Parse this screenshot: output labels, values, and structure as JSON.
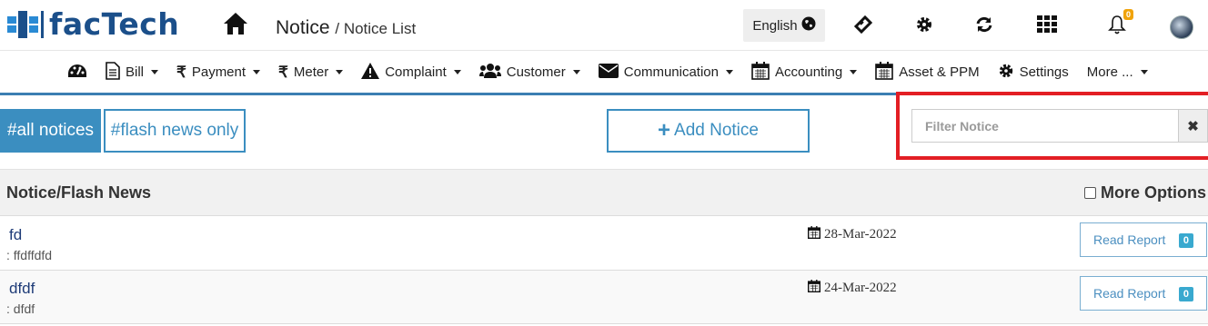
{
  "brand": {
    "name": "facTech"
  },
  "header": {
    "title": "Notice",
    "subtitle": "/ Notice List",
    "language": "English",
    "notification_count": "0"
  },
  "nav": {
    "items": [
      {
        "icon": "dashboard-icon",
        "label": ""
      },
      {
        "icon": "file-icon",
        "label": "Bill"
      },
      {
        "icon": "rupee-icon",
        "label": "Payment"
      },
      {
        "icon": "rupee-icon",
        "label": "Meter"
      },
      {
        "icon": "warning-icon",
        "label": "Complaint"
      },
      {
        "icon": "users-icon",
        "label": "Customer"
      },
      {
        "icon": "envelope-icon",
        "label": "Communication"
      },
      {
        "icon": "calendar-icon",
        "label": "Accounting"
      },
      {
        "icon": "calendar-icon",
        "label": "Asset & PPM"
      },
      {
        "icon": "gear-icon",
        "label": "Settings"
      },
      {
        "icon": "",
        "label": "More ..."
      }
    ]
  },
  "toolbar": {
    "all_notices": "#all notices",
    "flash_news": "#flash news only",
    "add_notice": "Add Notice",
    "filter_placeholder": "Filter Notice",
    "clear_symbol": "✖"
  },
  "table": {
    "title": "Notice/Flash News",
    "more_options": "More Options",
    "rows": [
      {
        "title": "fd",
        "description": ": ffdffdfd",
        "date": "28-Mar-2022",
        "action": "Read Report",
        "count": "0"
      },
      {
        "title": "dfdf",
        "description": ": dfdf",
        "date": "24-Mar-2022",
        "action": "Read Report",
        "count": "0"
      }
    ]
  },
  "colors": {
    "accent": "#3b8ec0",
    "brand": "#1b4f8a",
    "highlight": "#e31e24",
    "badge": "#f0a30a"
  }
}
